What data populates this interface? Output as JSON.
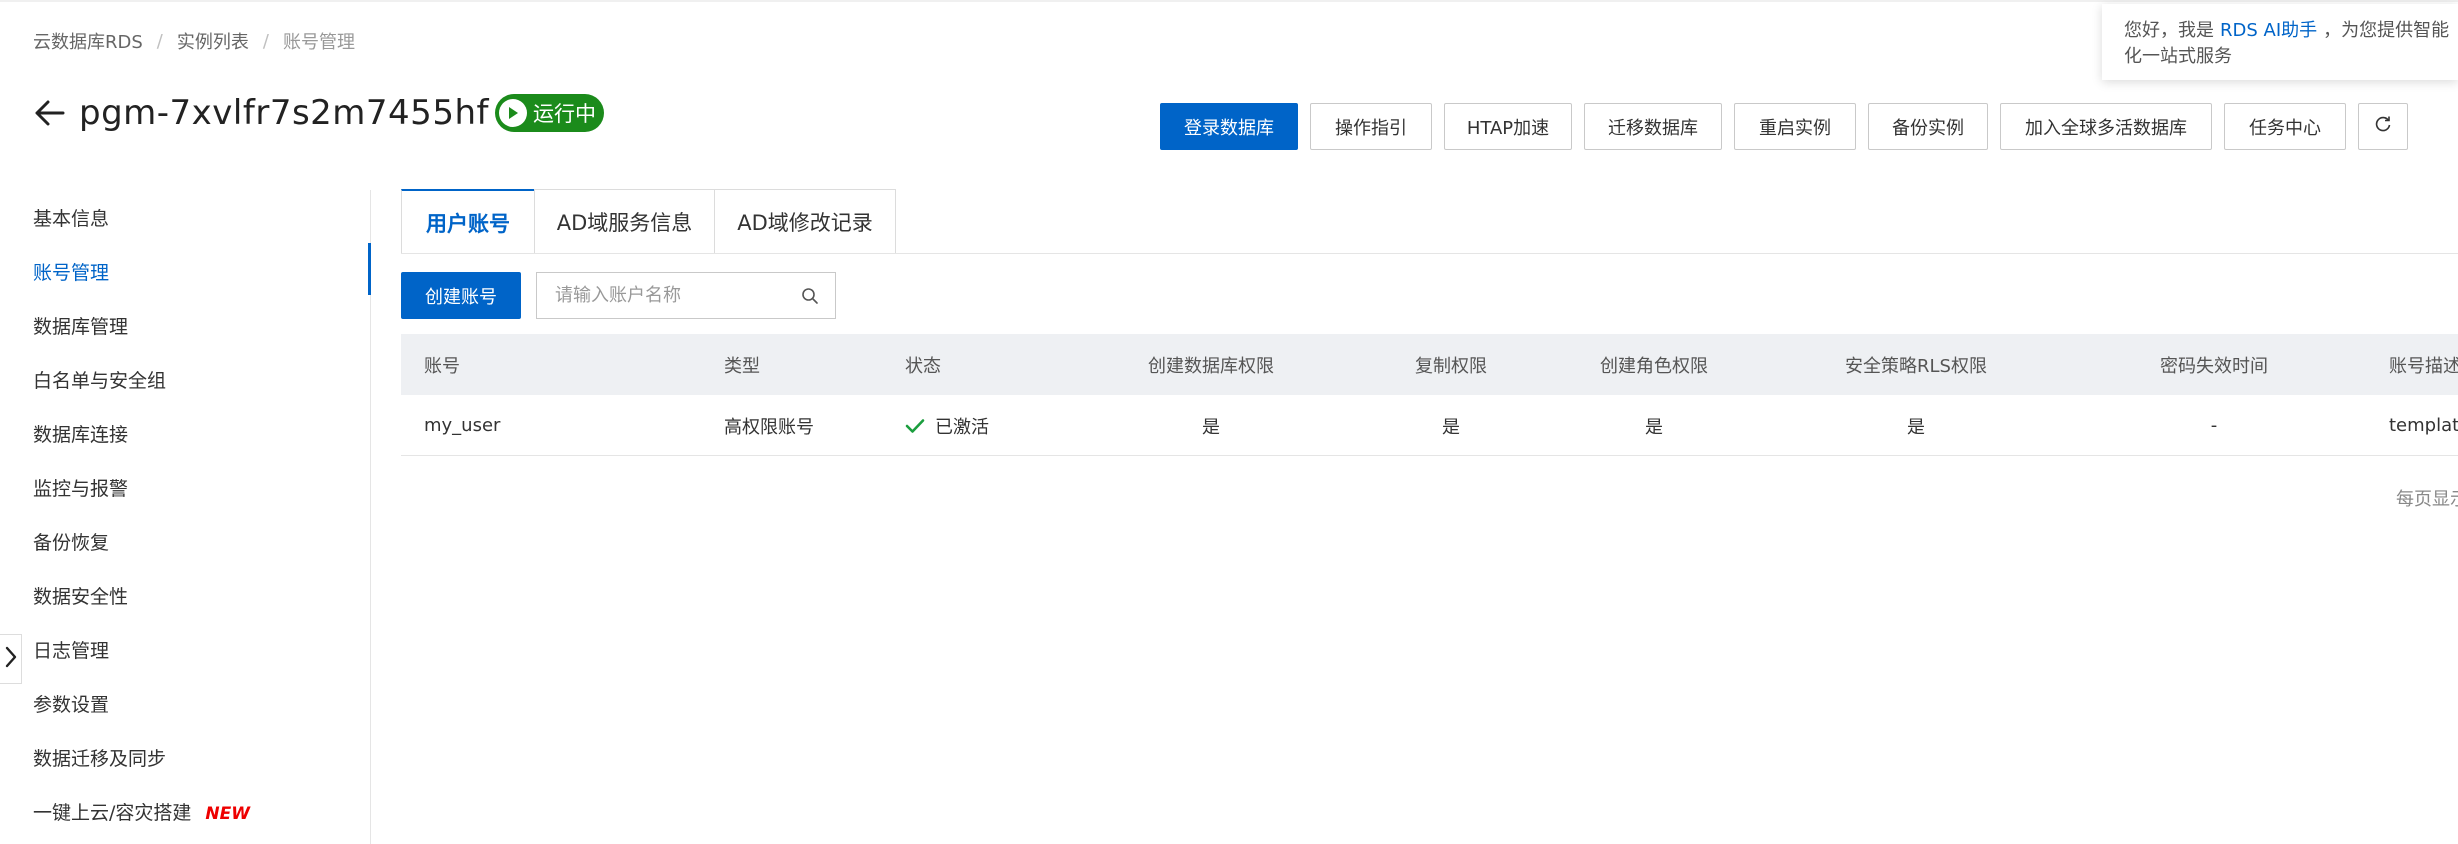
{
  "breadcrumb": [
    "云数据库RDS",
    "实例列表",
    "账号管理"
  ],
  "title": "pgm-7xvlfr7s2m7455hf",
  "status": "运行中",
  "toolbar": [
    "登录数据库",
    "操作指引",
    "HTAP加速",
    "迁移数据库",
    "重启实例",
    "备份实例",
    "加入全球多活数据库",
    "任务中心"
  ],
  "ai_popup": {
    "greeting": "您好，我是",
    "link": "RDS AI助手",
    "rest": "，为您提供智能",
    "line2": "化一站式服务"
  },
  "sidebar": {
    "items": [
      "基本信息",
      "账号管理",
      "数据库管理",
      "白名单与安全组",
      "数据库连接",
      "监控与报警",
      "备份恢复",
      "数据安全性",
      "日志管理",
      "参数设置",
      "数据迁移及同步",
      "一键上云/容灾搭建"
    ],
    "active": "账号管理",
    "new_badge": "NEW"
  },
  "tabs": [
    "用户账号",
    "AD域服务信息",
    "AD域修改记录"
  ],
  "create_button": "创建账号",
  "search_placeholder": "请输入账户名称",
  "table": {
    "headers": [
      "账号",
      "类型",
      "状态",
      "创建数据库权限",
      "复制权限",
      "创建角色权限",
      "安全策略RLS权限",
      "密码失效时间",
      "账号描述"
    ],
    "rows": [
      [
        "my_user",
        "高权限账号",
        "已激活",
        "是",
        "是",
        "是",
        "是",
        "-",
        "templat"
      ]
    ]
  },
  "per_page": "每页显示",
  "colors": {
    "primary": "#0064c8",
    "status_green": "#1b8b1b",
    "new_red": "#e00000"
  },
  "icons": [
    "back-arrow-icon",
    "play-icon",
    "refresh-icon",
    "search-icon",
    "check-icon",
    "chevron-right-icon"
  ]
}
